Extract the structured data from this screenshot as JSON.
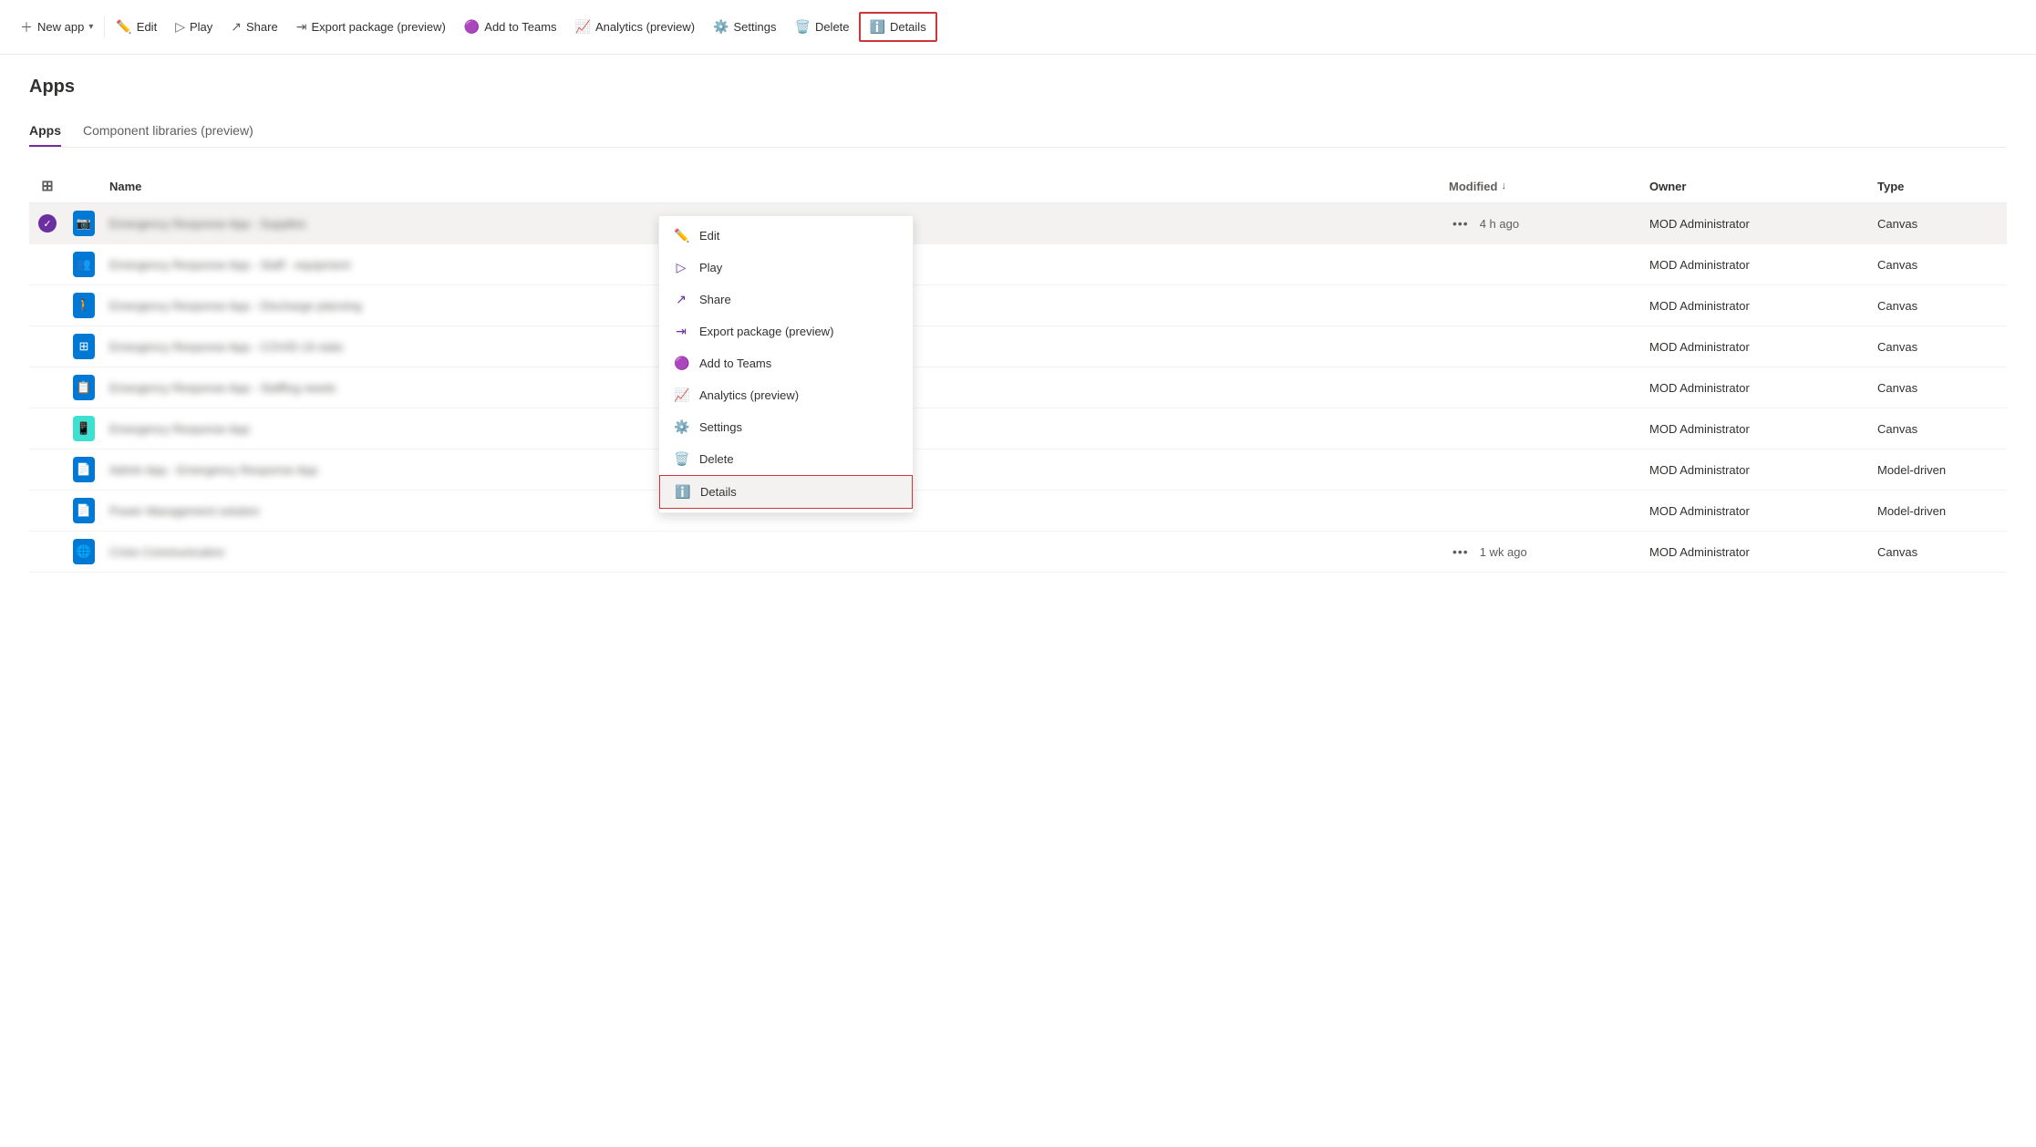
{
  "toolbar": {
    "new_app_label": "New app",
    "edit_label": "Edit",
    "play_label": "Play",
    "share_label": "Share",
    "export_label": "Export package (preview)",
    "add_to_teams_label": "Add to Teams",
    "analytics_label": "Analytics (preview)",
    "settings_label": "Settings",
    "delete_label": "Delete",
    "details_label": "Details"
  },
  "page": {
    "title": "Apps",
    "tabs": [
      {
        "id": "apps",
        "label": "Apps",
        "active": true
      },
      {
        "id": "component-libraries",
        "label": "Component libraries (preview)",
        "active": false
      }
    ]
  },
  "table": {
    "columns": [
      {
        "id": "check",
        "label": ""
      },
      {
        "id": "icon",
        "label": ""
      },
      {
        "id": "name",
        "label": "Name"
      },
      {
        "id": "modified",
        "label": "Modified",
        "sort": "desc"
      },
      {
        "id": "owner",
        "label": "Owner"
      },
      {
        "id": "type",
        "label": "Type"
      }
    ],
    "rows": [
      {
        "id": 1,
        "selected": true,
        "icon_color": "blue",
        "icon_type": "camera",
        "name": "Emergency Response App - Supplies",
        "modified": "4 h ago",
        "modified_dots": true,
        "owner": "MOD Administrator",
        "type": "Canvas"
      },
      {
        "id": 2,
        "selected": false,
        "icon_color": "blue",
        "icon_type": "people",
        "name": "Emergency Response App - Staff - equipment",
        "modified": "",
        "modified_dots": false,
        "owner": "MOD Administrator",
        "type": "Canvas"
      },
      {
        "id": 3,
        "selected": false,
        "icon_color": "blue",
        "icon_type": "person",
        "name": "Emergency Response App - Discharge planning",
        "modified": "",
        "modified_dots": false,
        "owner": "MOD Administrator",
        "type": "Canvas"
      },
      {
        "id": 4,
        "selected": false,
        "icon_color": "blue",
        "icon_type": "grid",
        "name": "Emergency Response App - COVID-19 stats",
        "modified": "",
        "modified_dots": false,
        "owner": "MOD Administrator",
        "type": "Canvas"
      },
      {
        "id": 5,
        "selected": false,
        "icon_color": "blue",
        "icon_type": "table",
        "name": "Emergency Response App - Staffing needs",
        "modified": "",
        "modified_dots": false,
        "owner": "MOD Administrator",
        "type": "Canvas"
      },
      {
        "id": 6,
        "selected": false,
        "icon_color": "light-blue",
        "icon_type": "app",
        "name": "Emergency Response App",
        "modified": "",
        "modified_dots": false,
        "owner": "MOD Administrator",
        "type": "Canvas"
      },
      {
        "id": 7,
        "selected": false,
        "icon_color": "blue",
        "icon_type": "model",
        "name": "Admin App - Emergency Response App",
        "modified": "",
        "modified_dots": false,
        "owner": "MOD Administrator",
        "type": "Model-driven"
      },
      {
        "id": 8,
        "selected": false,
        "icon_color": "blue",
        "icon_type": "model",
        "name": "Power Management solution",
        "modified": "",
        "modified_dots": false,
        "owner": "MOD Administrator",
        "type": "Model-driven"
      },
      {
        "id": 9,
        "selected": false,
        "icon_color": "blue",
        "icon_type": "globe",
        "name": "Crisis Communication",
        "modified": "1 wk ago",
        "modified_dots": true,
        "owner": "MOD Administrator",
        "type": "Canvas"
      }
    ]
  },
  "context_menu": {
    "items": [
      {
        "id": "edit",
        "label": "Edit",
        "icon": "edit"
      },
      {
        "id": "play",
        "label": "Play",
        "icon": "play"
      },
      {
        "id": "share",
        "label": "Share",
        "icon": "share"
      },
      {
        "id": "export",
        "label": "Export package (preview)",
        "icon": "export"
      },
      {
        "id": "add-to-teams",
        "label": "Add to Teams",
        "icon": "teams"
      },
      {
        "id": "analytics",
        "label": "Analytics (preview)",
        "icon": "analytics"
      },
      {
        "id": "settings",
        "label": "Settings",
        "icon": "settings"
      },
      {
        "id": "delete",
        "label": "Delete",
        "icon": "delete"
      },
      {
        "id": "details",
        "label": "Details",
        "icon": "info",
        "highlighted": true
      }
    ]
  }
}
